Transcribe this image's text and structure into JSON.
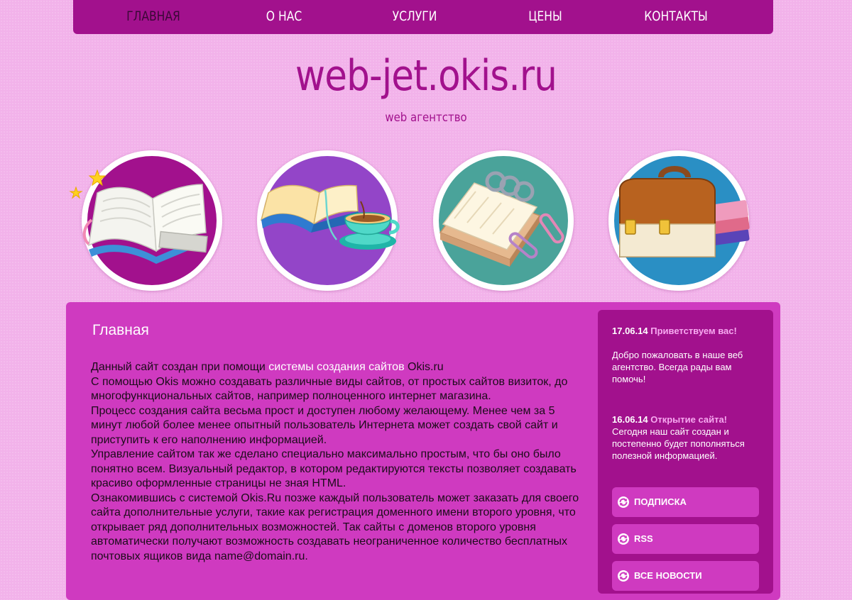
{
  "nav": {
    "items": [
      {
        "label": "ГЛАВНАЯ",
        "active": true
      },
      {
        "label": "О НАС"
      },
      {
        "label": "УСЛУГИ"
      },
      {
        "label": "ЦЕНЫ"
      },
      {
        "label": "КОНТАКТЫ"
      }
    ]
  },
  "header": {
    "title": "web-jet.okis.ru",
    "subtitle": "web агентство"
  },
  "circles": [
    {
      "icon": "open-book-with-stars-icon",
      "bg": "#a2118d"
    },
    {
      "icon": "book-and-coffee-cup-icon",
      "bg": "#9345c8"
    },
    {
      "icon": "notepad-with-paperclips-icon",
      "bg": "#4aa39a"
    },
    {
      "icon": "briefcase-and-books-icon",
      "bg": "#2a8fc4"
    }
  ],
  "main": {
    "title": "Главная",
    "intro": {
      "before": "Данный сайт создан при помощи ",
      "link": "системы создания сайтов",
      "after": " Okis.ru"
    },
    "paragraphs": [
      "С помощью Okis можно создавать различные виды сайтов, от простых сайтов визиток, до многофункциональных сайтов, например полноценного интернет магазина.",
      "Процесс создания сайта весьма прост и доступен любому желающему. Менее чем за 5 минут любой более менее опытный пользователь Интернета может создать свой сайт и приступить к его наполнению информацией.",
      "Управление сайтом так же сделано специально максимально простым, что бы оно было понятно всем. Визуальный редактор, в котором редактируются тексты позволяет создавать красиво оформленные страницы не зная HTML.",
      "Ознакомившись с системой Okis.Ru позже каждый пользователь может заказать для своего сайта дополнительные услуги, такие как регистрация доменного имени второго уровня, что открывает ряд дополнительных возможностей. Так сайты с доменов второго уровня автоматически получают возможность создавать неограниченное количество бесплатных почтовых ящиков вида name@domain.ru."
    ]
  },
  "sidebar": {
    "news": [
      {
        "date": "17.06.14",
        "title": "Приветствуем вас!",
        "text": "Добро пожаловать в наше веб агентство. Всегда рады вам помочь!"
      },
      {
        "date": "16.06.14",
        "title": "Открытие сайта!",
        "text": "Сегодня наш сайт создан и постепенно будет пополняться полезной информацией."
      }
    ],
    "buttons": [
      {
        "label": "ПОДПИСКА",
        "icon": "refresh-icon"
      },
      {
        "label": "RSS",
        "icon": "refresh-icon"
      },
      {
        "label": "ВСЕ НОВОСТИ",
        "icon": "refresh-icon"
      }
    ]
  },
  "colors": {
    "background": "#f2b2ea",
    "nav": "#a2118d",
    "main_panel": "#cf3ac0",
    "sidebar": "#a2118d",
    "news_title": "#f7a9f0"
  }
}
